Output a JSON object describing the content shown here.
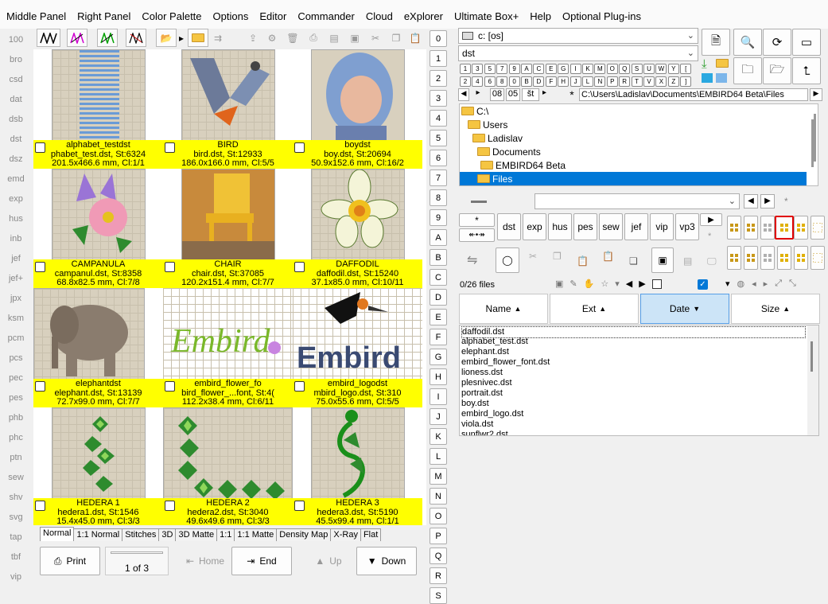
{
  "menu": [
    "Middle Panel",
    "Right Panel",
    "Color Palette",
    "Options",
    "Editor",
    "Commander",
    "Cloud",
    "eXplorer",
    "Ultimate Box+",
    "Help",
    "Optional Plug-ins"
  ],
  "left_strip": [
    "100",
    "bro",
    "csd",
    "dat",
    "dsb",
    "dst",
    "dsz",
    "emd",
    "exp",
    "hus",
    "inb",
    "jef",
    "jef+",
    "jpx",
    "ksm",
    "pcm",
    "pcs",
    "pec",
    "pes",
    "phb",
    "phc",
    "ptn",
    "sew",
    "shv",
    "svg",
    "tap",
    "tbf",
    "vip"
  ],
  "thumbnails": [
    {
      "title": "alphabet_testdst",
      "line2": "phabet_test.dst, St:6324",
      "line3": "201.5x466.6 mm, Cl:1/1"
    },
    {
      "title": "BIRD",
      "line2": "bird.dst, St:12933",
      "line3": "186.0x166.0 mm, Cl:5/5"
    },
    {
      "title": "boydst",
      "line2": "boy.dst, St:20694",
      "line3": "50.9x152.6 mm, Cl:16/2"
    },
    {
      "title": "CAMPANULA",
      "line2": "campanul.dst, St:8358",
      "line3": "68.8x82.5 mm, Cl:7/8"
    },
    {
      "title": "CHAIR",
      "line2": "chair.dst, St:37085",
      "line3": "120.2x151.4 mm, Cl:7/7"
    },
    {
      "title": "DAFFODIL",
      "line2": "daffodil.dst, St:15240",
      "line3": "37.1x85.0 mm, Cl:10/11"
    },
    {
      "title": "elephantdst",
      "line2": "elephant.dst, St:13139",
      "line3": "72.7x99.0 mm, Cl:7/7"
    },
    {
      "title": "embird_flower_fo",
      "line2": "bird_flower_...font, St:4(",
      "line3": "112.2x38.4 mm, Cl:6/11"
    },
    {
      "title": "embird_logodst",
      "line2": "mbird_logo.dst, St:310",
      "line3": "75.0x55.6 mm, Cl:5/5"
    },
    {
      "title": "HEDERA 1",
      "line2": "hedera1.dst, St:1546",
      "line3": "15.4x45.0 mm, Cl:3/3"
    },
    {
      "title": "HEDERA 2",
      "line2": "hedera2.dst, St:3040",
      "line3": "49.6x49.6 mm, Cl:3/3"
    },
    {
      "title": "HEDERA 3",
      "line2": "hedera3.dst, St:5190",
      "line3": "45.5x99.4 mm, Cl:1/1"
    }
  ],
  "view_tabs": [
    "Normal",
    "1:1 Normal",
    "Stitches",
    "3D",
    "3D Matte",
    "1:1",
    "1:1 Matte",
    "Density Map",
    "X-Ray",
    "Flat"
  ],
  "bottom": {
    "print": "Print",
    "page": "1 of 3",
    "home": "Home",
    "end": "End",
    "up": "Up",
    "down": "Down"
  },
  "num_buttons": [
    "0",
    "1",
    "2",
    "3",
    "4",
    "5",
    "6",
    "7",
    "8",
    "9",
    "A",
    "B",
    "C",
    "D",
    "E",
    "F",
    "G",
    "H",
    "I",
    "J",
    "K",
    "L",
    "M",
    "N",
    "O",
    "P",
    "Q",
    "R",
    "S"
  ],
  "drive": "c: [os]",
  "filter": "dst",
  "key_row1": [
    "1",
    "3",
    "5",
    "7",
    "9",
    "A",
    "C",
    "E",
    "G",
    "I",
    "K",
    "M",
    "O",
    "Q",
    "S",
    "U",
    "W",
    "Y",
    "["
  ],
  "key_row2": [
    "2",
    "4",
    "6",
    "8",
    "0",
    "B",
    "D",
    "F",
    "H",
    "J",
    "L",
    "N",
    "P",
    "R",
    "T",
    "V",
    "X",
    "Z",
    "]"
  ],
  "nav": {
    "a": "08",
    "b": "05",
    "c": "št",
    "star": "*",
    "path": "C:\\Users\\Ladislav\\Documents\\EMBIRD64 Beta\\Files"
  },
  "tree": [
    "C:\\",
    "Users",
    "Ladislav",
    "Documents",
    "EMBIRD64 Beta",
    "Files"
  ],
  "filter_buttons": [
    "dst",
    "exp",
    "hus",
    "pes",
    "sew",
    "jef",
    "vip",
    "vp3"
  ],
  "file_count": "0/26 files",
  "columns": [
    {
      "label": "Name",
      "arrow": "▲"
    },
    {
      "label": "Ext",
      "arrow": "▲"
    },
    {
      "label": "Date",
      "arrow": "▼"
    },
    {
      "label": "Size",
      "arrow": "▲"
    }
  ],
  "files": [
    "daffodil.dst",
    "alphabet_test.dst",
    "elephant.dst",
    "embird_flower_font.dst",
    "lioness.dst",
    "plesnivec.dst",
    "portrait.dst",
    "boy.dst",
    "embird_logo.dst",
    "viola.dst",
    "sunflwr2.dst"
  ],
  "colors": {
    "yellow": "#ffff00",
    "selection": "#0078d7",
    "highlight_red": "#e00000",
    "header_sel": "#cce4f7"
  }
}
